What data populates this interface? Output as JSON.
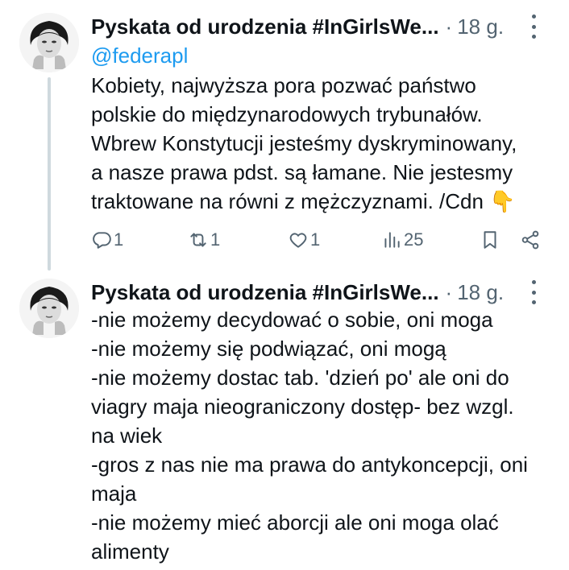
{
  "tweets": [
    {
      "author": "Pyskata od urodzenia #InGirlsWe...",
      "time": "18 g.",
      "reply_to": "@federapl",
      "lines": [
        "Kobiety, najwyższa pora pozwać państwo",
        "polskie do międzynarodowych trybunałów.",
        "Wbrew Konstytucji jesteśmy dyskryminowany,",
        "a nasze prawa pdst. są łamane. Nie jestesmy",
        "traktowane na równi z mężczyznami. /Cdn 👇"
      ],
      "stats": {
        "replies": "1",
        "reposts": "1",
        "likes": "1",
        "views": "25"
      }
    },
    {
      "author": "Pyskata od urodzenia #InGirlsWe...",
      "time": "18 g.",
      "lines": [
        "-nie możemy decydować o sobie, oni moga",
        "-nie możemy się podwiązać, oni mogą",
        "-nie możemy dostac tab. 'dzień po' ale oni do",
        "viagry maja nieograniczony dostęp- bez wzgl.",
        "na wiek",
        "-gros z nas nie ma prawa do antykoncepcji, oni",
        "maja",
        "-nie możemy mieć aborcji ale oni moga olać",
        "alimenty"
      ]
    }
  ],
  "icons": {
    "reply": "speech-bubble-icon",
    "repost": "repost-arrows-icon",
    "like": "heart-icon",
    "views": "bar-chart-icon",
    "bookmark": "bookmark-icon",
    "share": "share-icon",
    "more": "vertical-dots-icon"
  },
  "colors": {
    "link": "#1d9bf0",
    "secondary": "#536471",
    "text": "#0f1419",
    "thread_line": "#cfd9de"
  }
}
